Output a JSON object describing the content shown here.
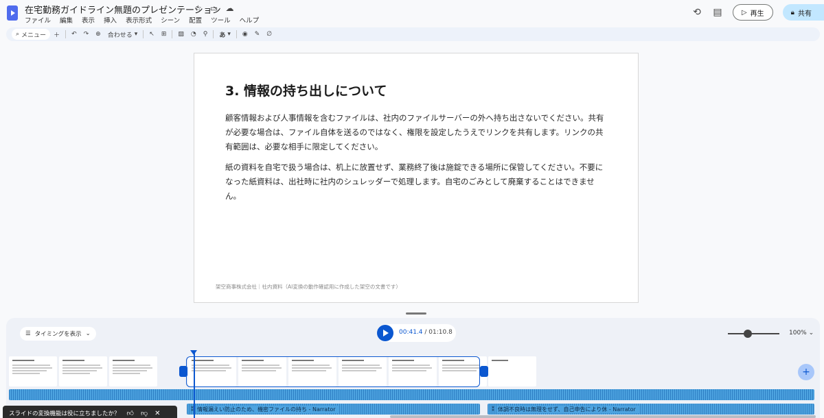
{
  "header": {
    "title": "在宅勤務ガイドライン無題のプレゼンテーション",
    "menu": [
      "ファイル",
      "編集",
      "表示",
      "挿入",
      "表示形式",
      "シーン",
      "配置",
      "ツール",
      "ヘルプ"
    ],
    "play_label": "再生",
    "share_label": "共有"
  },
  "toolbar": {
    "search_label": "メニュー",
    "zoom_label": "合わせる",
    "text_style_glyph": "あ"
  },
  "slide": {
    "title": "3. 情報の持ち出しについて",
    "paragraphs": [
      "顧客情報および人事情報を含むファイルは、社内のファイルサーバーの外へ持ち出さないでください。共有が必要な場合は、ファイル自体を送るのではなく、権限を設定したうえでリンクを共有します。リンクの共有範囲は、必要な相手に限定してください。",
      "紙の資料を自宅で扱う場合は、机上に放置せず、業務終了後は施錠できる場所に保管してください。不要になった紙資料は、出社時に社内のシュレッダーで処理します。自宅のごみとして廃棄することはできません。"
    ],
    "footer": "架空商事株式会社｜社内資料（AI変換の動作確認用に作成した架空の文書です）"
  },
  "timeline": {
    "timing_label": "タイミングを表示",
    "current_time": "00:41.4",
    "total_time": " / 01:10.8",
    "zoom_percent": "100%",
    "zoom_level": 0.38,
    "tracks": [
      "情報漏えい防止のため、機密ファイルの持ち - Narrator",
      "体調不良時は無理をせず、自己申告により休 - Narrator"
    ]
  },
  "toast": {
    "message": "スライドの変換機能は役に立ちましたか？"
  }
}
